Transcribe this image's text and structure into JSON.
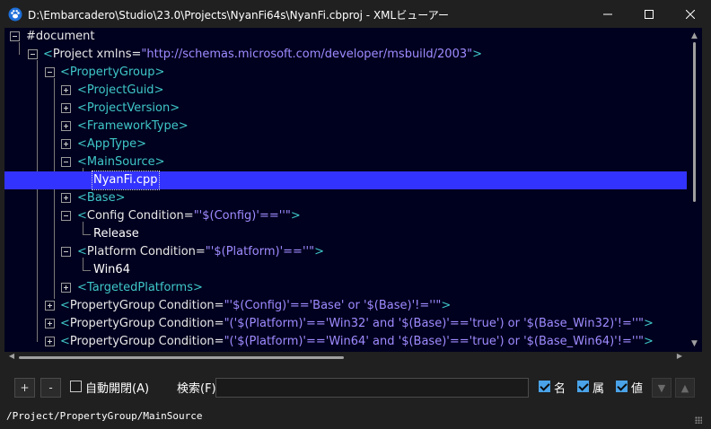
{
  "window": {
    "title": "D:\\Embarcadero\\Studio\\23.0\\Projects\\NyanFi64s\\NyanFi.cbproj - XMLビューアー",
    "app_icon": "paw-icon",
    "controls": {
      "minimize": "—",
      "maximize": "☐",
      "close": "✕"
    }
  },
  "tree": {
    "rows": [
      {
        "tag": "",
        "name": "#document",
        "attr": "",
        "tail": ""
      },
      {
        "tag": "<",
        "name": "Project xmlns=",
        "attr": "\"http://schemas.microsoft.com/developer/msbuild/2003\"",
        "tail": ">"
      },
      {
        "tag": "<",
        "name": "PropertyGroup",
        "attr": "",
        "tail": ">"
      },
      {
        "tag": "<",
        "name": "ProjectGuid",
        "attr": "",
        "tail": ">"
      },
      {
        "tag": "<",
        "name": "ProjectVersion",
        "attr": "",
        "tail": ">"
      },
      {
        "tag": "<",
        "name": "FrameworkType",
        "attr": "",
        "tail": ">"
      },
      {
        "tag": "<",
        "name": "AppType",
        "attr": "",
        "tail": ">"
      },
      {
        "tag": "<",
        "name": "MainSource",
        "attr": "",
        "tail": ">"
      },
      {
        "text": "NyanFi.cpp"
      },
      {
        "tag": "<",
        "name": "Base",
        "attr": "",
        "tail": ">"
      },
      {
        "tag": "<",
        "name": "Config Condition=",
        "attr": "\"'$(Config)'==''\"",
        "tail": ">"
      },
      {
        "text": "Release"
      },
      {
        "tag": "<",
        "name": "Platform Condition=",
        "attr": "\"'$(Platform)'==''\"",
        "tail": ">"
      },
      {
        "text": "Win64"
      },
      {
        "tag": "<",
        "name": "TargetedPlatforms",
        "attr": "",
        "tail": ">"
      },
      {
        "tag": "<",
        "name": "PropertyGroup Condition=",
        "attr": "\"'$(Config)'=='Base' or '$(Base)'!=''\"",
        "tail": ">"
      },
      {
        "tag": "<",
        "name": "PropertyGroup Condition=",
        "attr": "\"('$(Platform)'=='Win32' and '$(Base)'=='true') or '$(Base_Win32)'!=''\"",
        "tail": ">"
      },
      {
        "tag": "<",
        "name": "PropertyGroup Condition=",
        "attr": "\"('$(Platform)'=='Win64' and '$(Base)'=='true') or '$(Base_Win64)'!=''\"",
        "tail": ">"
      }
    ],
    "selected_index": 8
  },
  "toolbar": {
    "expand_label": "+",
    "collapse_label": "-",
    "auto_expand_label": "自動開閉(A)",
    "auto_expand_checked": false,
    "search_label": "検索(F)",
    "search_value": "",
    "filter_name_label": "名",
    "filter_name_checked": true,
    "filter_attr_label": "属",
    "filter_attr_checked": true,
    "filter_value_label": "値",
    "filter_value_checked": true,
    "next_icon": "arrow-down-icon",
    "prev_icon": "arrow-up-icon"
  },
  "status": {
    "path": "/Project/PropertyGroup/MainSource"
  },
  "colors": {
    "tree_background": "#00001f",
    "selection": "#3333ff",
    "tag": "#3fc8c8",
    "attr_value": "#9f8cff",
    "checkbox_accent": "#4aa3e8"
  }
}
